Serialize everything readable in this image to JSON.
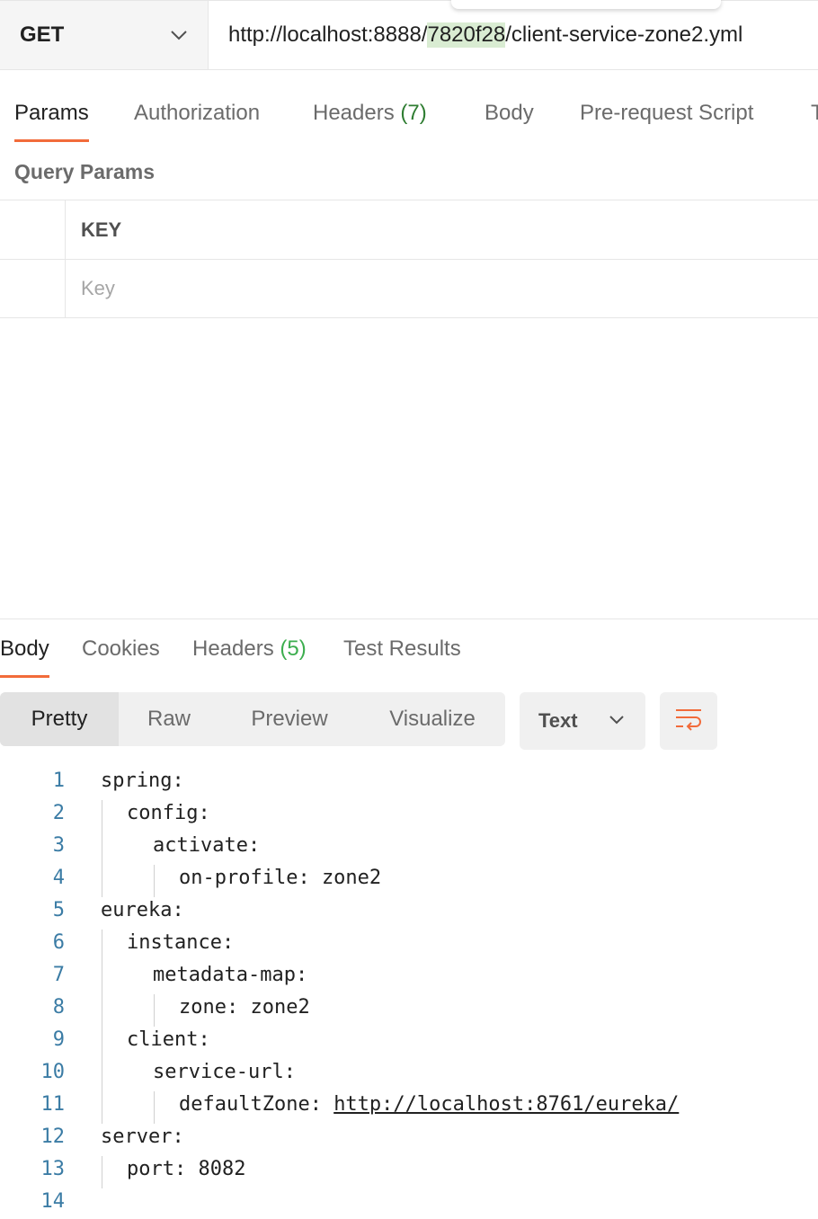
{
  "request": {
    "method": "GET",
    "url_before": "http://localhost:8888/",
    "url_highlight": "7820f28",
    "url_after": "/client-service-zone2.yml"
  },
  "request_tabs": [
    {
      "label": "Params",
      "count": ""
    },
    {
      "label": "Authorization",
      "count": ""
    },
    {
      "label": "Headers",
      "count": "(7)"
    },
    {
      "label": "Body",
      "count": ""
    },
    {
      "label": "Pre-request Script",
      "count": ""
    },
    {
      "label": "T",
      "count": ""
    }
  ],
  "query_params": {
    "title": "Query Params",
    "key_header": "KEY",
    "key_placeholder": "Key"
  },
  "response_tabs": [
    {
      "label": "Body",
      "count": ""
    },
    {
      "label": "Cookies",
      "count": ""
    },
    {
      "label": "Headers",
      "count": "(5)"
    },
    {
      "label": "Test Results",
      "count": ""
    }
  ],
  "view_modes": [
    "Pretty",
    "Raw",
    "Preview",
    "Visualize"
  ],
  "format": "Text",
  "code_lines": [
    {
      "n": "1",
      "text": "spring:"
    },
    {
      "n": "2",
      "text": "config:"
    },
    {
      "n": "3",
      "text": "activate:"
    },
    {
      "n": "4",
      "text": "on-profile: zone2"
    },
    {
      "n": "5",
      "text": "eureka:"
    },
    {
      "n": "6",
      "text": "instance:"
    },
    {
      "n": "7",
      "text": "metadata-map:"
    },
    {
      "n": "8",
      "text": "zone: zone2"
    },
    {
      "n": "9",
      "text": "client:"
    },
    {
      "n": "10",
      "text": "service-url:"
    },
    {
      "n": "11",
      "key": "defaultZone: ",
      "link": "http://localhost:8761/eureka/"
    },
    {
      "n": "12",
      "text": "server:"
    },
    {
      "n": "13",
      "text": "port: 8082"
    },
    {
      "n": "14",
      "text": ""
    }
  ],
  "colors": {
    "accent": "#f26b3a",
    "count_green": "#2f7d32",
    "line_number": "#3b7ca5"
  }
}
